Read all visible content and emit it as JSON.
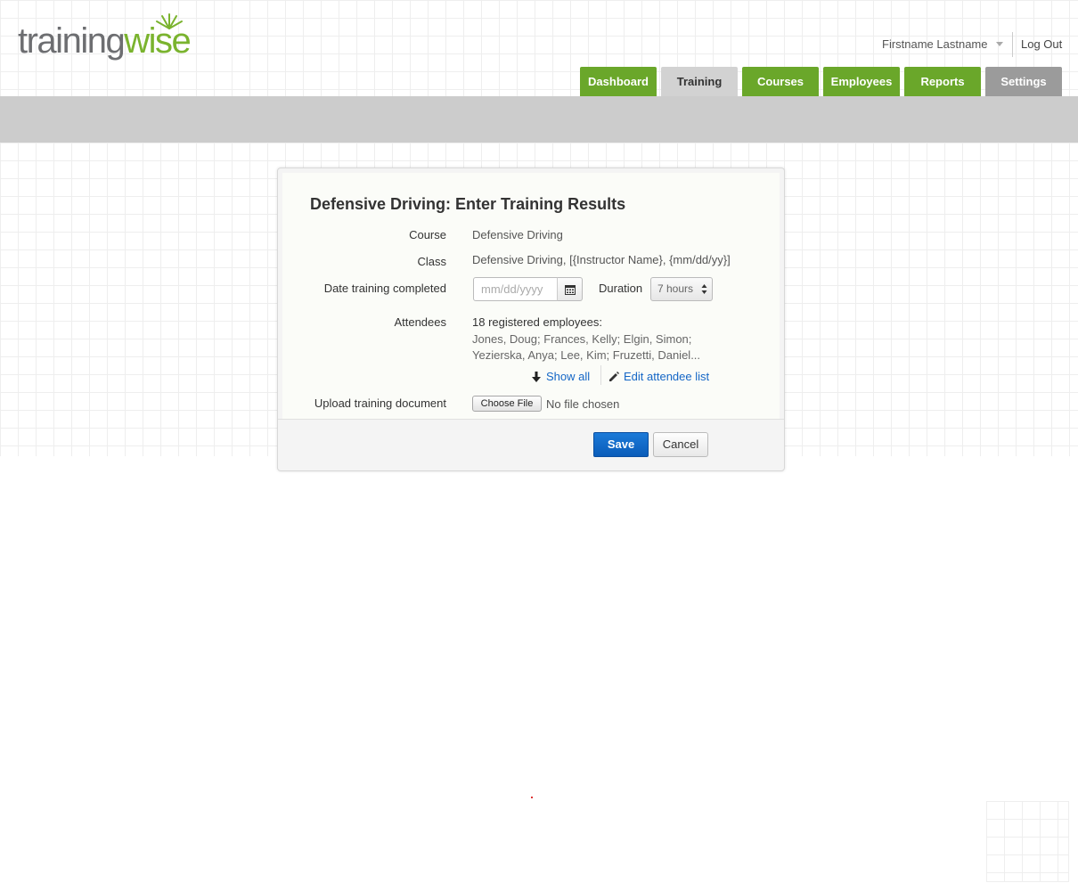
{
  "brand": {
    "part1": "training",
    "part2": "wise",
    "accent": "#7ab32e",
    "gray": "#6d6e71"
  },
  "header": {
    "user_name": "Firstname Lastname",
    "logout": "Log Out",
    "tabs": [
      {
        "label": "Dashboard",
        "state": "green"
      },
      {
        "label": "Training",
        "state": "active"
      },
      {
        "label": "Courses",
        "state": "green"
      },
      {
        "label": "Employees",
        "state": "green"
      },
      {
        "label": "Reports",
        "state": "green"
      },
      {
        "label": "Settings",
        "state": "gray"
      }
    ]
  },
  "dialog": {
    "title": "Defensive Driving: Enter Training Results",
    "course_label": "Course",
    "course_value": "Defensive Driving",
    "class_label": "Class",
    "class_value": "Defensive Driving, [{Instructor Name}, {mm/dd/yy}]",
    "date_label": "Date training completed",
    "date_placeholder": "mm/dd/yyyy",
    "duration_label": "Duration",
    "duration_value": "7 hours",
    "attendees_label": "Attendees",
    "attendees_count": "18 registered employees:",
    "attendees_list": "Jones, Doug; Frances, Kelly; Elgin, Simon; Yezierska, Anya; Lee, Kim; Fruzetti, Daniel...",
    "show_all": "Show all",
    "edit_attendees": "Edit attendee list",
    "upload_label": "Upload training document",
    "choose_file": "Choose File",
    "no_file": "No file chosen",
    "save": "Save",
    "cancel": "Cancel"
  }
}
